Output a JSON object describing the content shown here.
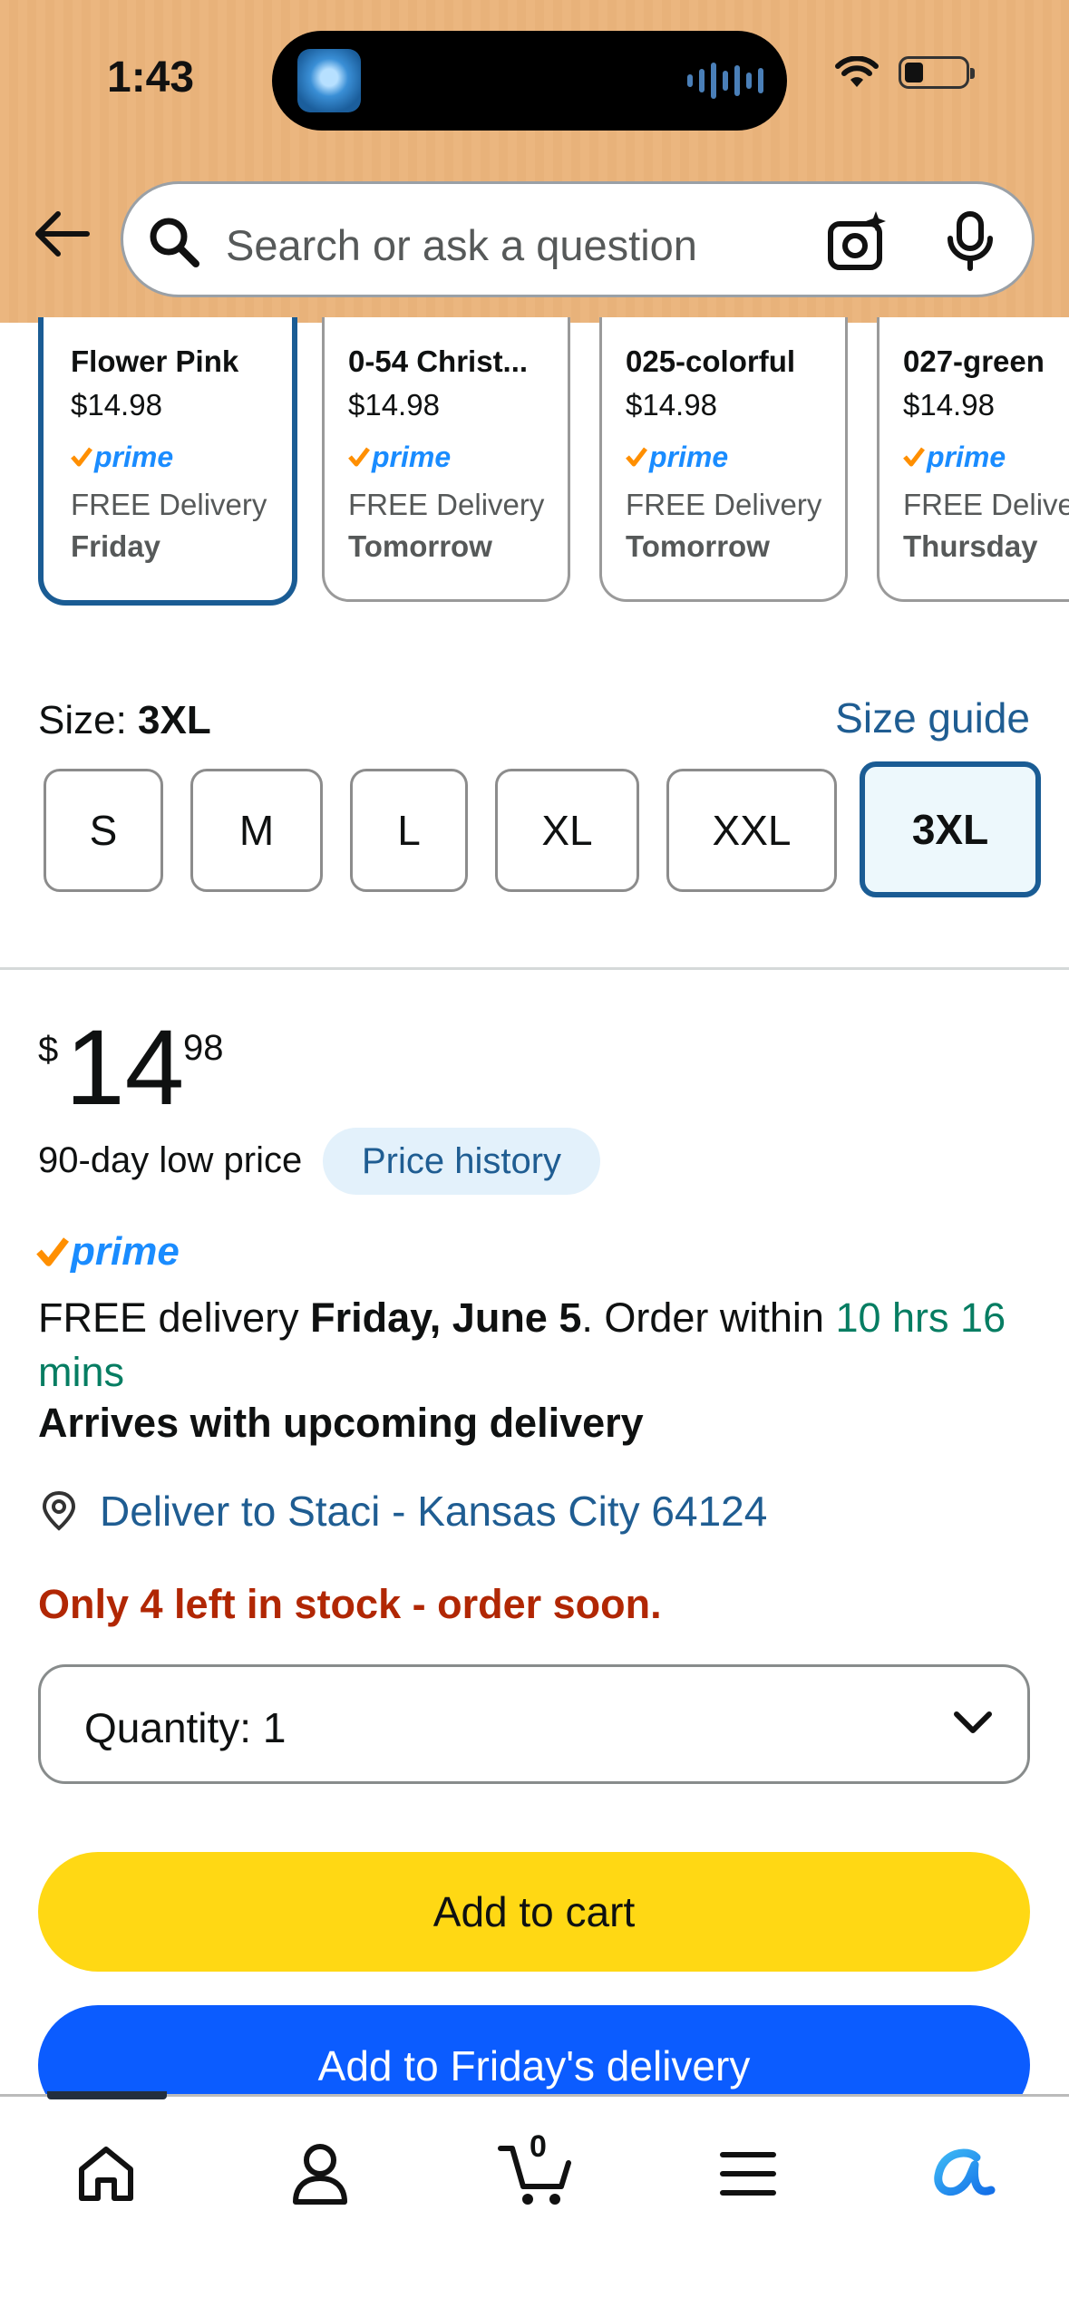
{
  "status_bar": {
    "time": "1:43"
  },
  "search": {
    "placeholder": "Search or ask a question"
  },
  "swatches": [
    {
      "name": "Flower Pink",
      "price": "$14.98",
      "prime": "prime",
      "delivery": "FREE Delivery",
      "day": "Friday",
      "selected": true
    },
    {
      "name": "0-54 Christ...",
      "price": "$14.98",
      "prime": "prime",
      "delivery": "FREE Delivery",
      "day": "Tomorrow",
      "selected": false
    },
    {
      "name": "025-colorful",
      "price": "$14.98",
      "prime": "prime",
      "delivery": "FREE Delivery",
      "day": "Tomorrow",
      "selected": false
    },
    {
      "name": "027-green",
      "price": "$14.98",
      "prime": "prime",
      "delivery": "FREE Deliver",
      "day": "Thursday",
      "selected": false
    }
  ],
  "size": {
    "label": "Size: ",
    "selected": "3XL",
    "guide": "Size guide",
    "options": [
      "S",
      "M",
      "L",
      "XL",
      "XXL",
      "3XL"
    ]
  },
  "price": {
    "symbol": "$",
    "whole": "14",
    "fraction": "98",
    "low_price_label": "90-day low price",
    "history_label": "Price history"
  },
  "prime_label": "prime",
  "delivery": {
    "prefix": "FREE delivery ",
    "date": "Friday, June 5",
    "middle": ". Order within ",
    "countdown": "10 hrs 16 mins",
    "arrives": "Arrives with upcoming delivery",
    "location": "Deliver to Staci - Kansas City 64124"
  },
  "stock": "Only 4 left in stock - order soon.",
  "quantity": {
    "label": "Quantity:",
    "value": "1"
  },
  "buttons": {
    "add_to_cart": "Add to cart",
    "add_to_delivery": "Add to Friday's delivery"
  },
  "nav": {
    "cart_count": "0"
  },
  "colors": {
    "header_bg": "#ebb67f",
    "link_blue": "#1f5d92",
    "selected_border": "#1a5c94",
    "cart_yellow": "#ffd814",
    "delivery_blue": "#0b5cff",
    "stock_red": "#b12704",
    "countdown_green": "#067d62"
  }
}
